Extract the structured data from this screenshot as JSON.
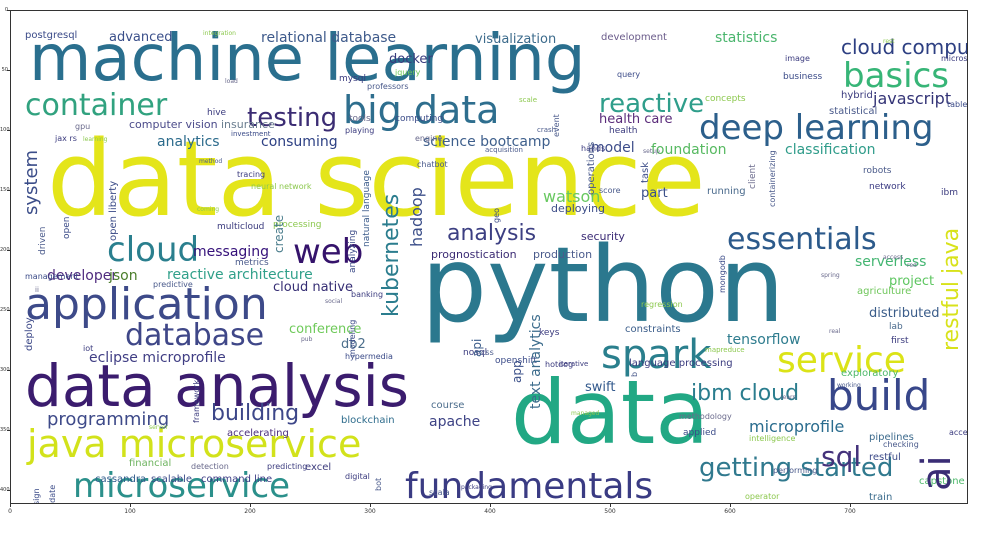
{
  "words": [
    {
      "text": "machine learning",
      "color": "#2a6f8e"
    },
    {
      "text": "data science",
      "color": "#e4e51a"
    },
    {
      "text": "python",
      "color": "#2b788e"
    },
    {
      "text": "data",
      "color": "#22a884"
    },
    {
      "text": "data analysis",
      "color": "#3b1c6e"
    },
    {
      "text": "java microservice",
      "color": "#d2e21b"
    },
    {
      "text": "big data",
      "color": "#2e6e8e"
    },
    {
      "text": "application",
      "color": "#3d4a89"
    },
    {
      "text": "deep learning",
      "color": "#2c5f8b"
    },
    {
      "text": "container",
      "color": "#31a27f"
    },
    {
      "text": "microservice",
      "color": "#2b908b"
    },
    {
      "text": "fundamentals",
      "color": "#3a3b83"
    },
    {
      "text": "cloud",
      "color": "#2a7f8e"
    },
    {
      "text": "web",
      "color": "#35136b"
    },
    {
      "text": "service",
      "color": "#dbe317"
    },
    {
      "text": "spark",
      "color": "#2a7f8d"
    },
    {
      "text": "build",
      "color": "#38478a"
    },
    {
      "text": "database",
      "color": "#3f4788"
    },
    {
      "text": "essentials",
      "color": "#2c5a8b"
    },
    {
      "text": "basics",
      "color": "#37b577"
    },
    {
      "text": "cloud computing",
      "color": "#2d3f82"
    },
    {
      "text": "testing",
      "color": "#3b2c73"
    },
    {
      "text": "reactive",
      "color": "#2f9e8b"
    },
    {
      "text": "getting started",
      "color": "#30798e"
    },
    {
      "text": "sql",
      "color": "#44327b"
    },
    {
      "text": "analysis",
      "color": "#3c3f82"
    },
    {
      "text": "ibm cloud",
      "color": "#2a7d8e"
    },
    {
      "text": "building",
      "color": "#3d4789"
    },
    {
      "text": "programming",
      "color": "#3e4a89"
    },
    {
      "text": "eclipse microprofile",
      "color": "#403e84"
    },
    {
      "text": "reactive architecture",
      "color": "#30a08a"
    },
    {
      "text": "javascript",
      "color": "#333376"
    },
    {
      "text": "messaging",
      "color": "#35117a"
    },
    {
      "text": "cloud native",
      "color": "#362e74"
    },
    {
      "text": "developer",
      "color": "#4f2b7e"
    },
    {
      "text": "json",
      "color": "#4a7d2a"
    },
    {
      "text": "consuming",
      "color": "#2c3f83"
    },
    {
      "text": "analytics",
      "color": "#2c6b8c"
    },
    {
      "text": "classification",
      "color": "#2f9c8a"
    },
    {
      "text": "foundation",
      "color": "#56b960"
    },
    {
      "text": "model",
      "color": "#3d4d8a"
    },
    {
      "text": "science bootcamp",
      "color": "#3e5f8c"
    },
    {
      "text": "health care",
      "color": "#5a2b7a"
    },
    {
      "text": "watson",
      "color": "#68c860"
    },
    {
      "text": "part",
      "color": "#3b5089"
    },
    {
      "text": "tensorflow",
      "color": "#2e7c8e"
    },
    {
      "text": "microprofile",
      "color": "#2a6c8e"
    },
    {
      "text": "serverless",
      "color": "#43b571"
    },
    {
      "text": "project",
      "color": "#5ec661"
    },
    {
      "text": "distributed",
      "color": "#3b5d8a"
    },
    {
      "text": "conference",
      "color": "#6fca5a"
    },
    {
      "text": "db2",
      "color": "#4d6f8c"
    },
    {
      "text": "apache",
      "color": "#3e4385"
    },
    {
      "text": "swift",
      "color": "#31588c"
    },
    {
      "text": "relational database",
      "color": "#3e5a8b"
    },
    {
      "text": "visualization",
      "color": "#3c6b8c"
    },
    {
      "text": "statistics",
      "color": "#4ab56d"
    },
    {
      "text": "advanced",
      "color": "#3a4f8a"
    },
    {
      "text": "postgresql",
      "color": "#3b4b89"
    },
    {
      "text": "docker",
      "color": "#383b7d"
    },
    {
      "text": "computer vision",
      "color": "#4b4b8a"
    },
    {
      "text": "insurance",
      "color": "#6a7d8f"
    },
    {
      "text": "development",
      "color": "#6a5b8a"
    },
    {
      "text": "production",
      "color": "#4a5b8c"
    },
    {
      "text": "deploying",
      "color": "#3d4e88"
    },
    {
      "text": "security",
      "color": "#3b2b76"
    },
    {
      "text": "prognostication",
      "color": "#3b2b74"
    },
    {
      "text": "course",
      "color": "#4c6d8c"
    },
    {
      "text": "blockchain",
      "color": "#2e6c8c"
    },
    {
      "text": "accelerating",
      "color": "#4b2e7c"
    },
    {
      "text": "command line",
      "color": "#3a3b84"
    },
    {
      "text": "scalable",
      "color": "#3a4b89"
    },
    {
      "text": "cassandra",
      "color": "#2e5b8b"
    },
    {
      "text": "excel",
      "color": "#3c3b7c"
    },
    {
      "text": "financial",
      "color": "#6db35f"
    },
    {
      "text": "network",
      "color": "#3a3a82"
    },
    {
      "text": "exploratory",
      "color": "#4db86a"
    },
    {
      "text": "pipelines",
      "color": "#3c6a8c"
    },
    {
      "text": "restful",
      "color": "#3c4a88"
    },
    {
      "text": "capstone",
      "color": "#4db86a"
    },
    {
      "text": "train",
      "color": "#3b6b8c"
    },
    {
      "text": "language processing",
      "color": "#3a3b7e"
    },
    {
      "text": "constraints",
      "color": "#3b5d8a"
    },
    {
      "text": "ai",
      "color": "#3a2d75"
    },
    {
      "text": "restful java",
      "color": "#d8e21a"
    },
    {
      "text": "kubernetes",
      "color": "#2b7d8e"
    },
    {
      "text": "system",
      "color": "#3b4d89"
    },
    {
      "text": "hadoop",
      "color": "#3b4e89"
    },
    {
      "text": "text analytics",
      "color": "#3c6c8c"
    },
    {
      "text": "api",
      "color": "#3c5d8b"
    },
    {
      "text": "app",
      "color": "#3b5089"
    },
    {
      "text": "create",
      "color": "#4b7d8c"
    },
    {
      "text": "open liberty",
      "color": "#3d4d88"
    },
    {
      "text": "open",
      "color": "#3b4b88"
    },
    {
      "text": "driven",
      "color": "#4a5a8b"
    },
    {
      "text": "deploy",
      "color": "#3b4787"
    },
    {
      "text": "analyzing",
      "color": "#3b4b88"
    },
    {
      "text": "natural language",
      "color": "#3b5b8b"
    },
    {
      "text": "operations",
      "color": "#4a5a8b"
    },
    {
      "text": "task",
      "color": "#3d4e89"
    },
    {
      "text": "running",
      "color": "#4a6a8c"
    },
    {
      "text": "client",
      "color": "#6a6a8c"
    },
    {
      "text": "robots",
      "color": "#4a5a8a"
    },
    {
      "text": "ibm",
      "color": "#3b3b7e"
    },
    {
      "text": "agriculture",
      "color": "#6ec65a"
    },
    {
      "text": "lab",
      "color": "#4a6a8c"
    },
    {
      "text": "first",
      "color": "#3b3b7e"
    },
    {
      "text": "hybrid",
      "color": "#3b3b7e"
    },
    {
      "text": "statistical",
      "color": "#4a5a8b"
    },
    {
      "text": "table",
      "color": "#3b4b88"
    },
    {
      "text": "business",
      "color": "#3b4b88"
    },
    {
      "text": "image",
      "color": "#3b3b7e"
    },
    {
      "text": "query",
      "color": "#3b4b88"
    },
    {
      "text": "concepts",
      "color": "#8cc84e"
    },
    {
      "text": "mysql",
      "color": "#3b3b7e"
    },
    {
      "text": "jquery",
      "color": "#6ec65a"
    },
    {
      "text": "professors",
      "color": "#4a5a8b"
    },
    {
      "text": "tools",
      "color": "#6a6a8c"
    },
    {
      "text": "computing",
      "color": "#3b4b88"
    },
    {
      "text": "health",
      "color": "#3b3b7e"
    },
    {
      "text": "gpu",
      "color": "#6a6a8c"
    },
    {
      "text": "jax rs",
      "color": "#3b3b7e"
    },
    {
      "text": "investment",
      "color": "#3b4b88"
    },
    {
      "text": "playing",
      "color": "#3b3b7e"
    },
    {
      "text": "hive",
      "color": "#3b3b7e"
    },
    {
      "text": "metrics",
      "color": "#4a5a8b"
    },
    {
      "text": "multicloud",
      "color": "#3b3b7e"
    },
    {
      "text": "processing",
      "color": "#8cc84e"
    },
    {
      "text": "management",
      "color": "#3b4b88"
    },
    {
      "text": "predictive",
      "color": "#4a5a8b"
    },
    {
      "text": "banking",
      "color": "#3b3b7e"
    },
    {
      "text": "modeling",
      "color": "#3b4b88"
    },
    {
      "text": "nosql",
      "color": "#3b3b7e"
    },
    {
      "text": "iot",
      "color": "#3b3b7e"
    },
    {
      "text": "hypermedia",
      "color": "#3b4b88"
    },
    {
      "text": "css",
      "color": "#4a5a8b"
    },
    {
      "text": "keys",
      "color": "#3b3b7e"
    },
    {
      "text": "hotdog",
      "color": "#3b3b7e"
    },
    {
      "text": "openshift",
      "color": "#3b4b88"
    },
    {
      "text": "mapreduce",
      "color": "#8cc84e"
    },
    {
      "text": "intelligence",
      "color": "#8cc84e"
    },
    {
      "text": "applied",
      "color": "#3b4b88"
    },
    {
      "text": "methodology",
      "color": "#6a6a8c"
    },
    {
      "text": "checking",
      "color": "#4a5a8b"
    },
    {
      "text": "performing",
      "color": "#4a5a8b"
    },
    {
      "text": "operator",
      "color": "#8cc84e"
    },
    {
      "text": "design",
      "color": "#3b4b88"
    },
    {
      "text": "update",
      "color": "#3b4b88"
    },
    {
      "text": "detection",
      "color": "#6a6a8c"
    },
    {
      "text": "framework",
      "color": "#3b3b7e"
    },
    {
      "text": "scala",
      "color": "#4a5a8b"
    },
    {
      "text": "accessing",
      "color": "#4a5a8b"
    },
    {
      "text": "bot",
      "color": "#3b3b7e"
    },
    {
      "text": "chatbot",
      "color": "#3b4b88"
    },
    {
      "text": "engine",
      "color": "#4a5a8b"
    },
    {
      "text": "hands",
      "color": "#6a6a8c"
    },
    {
      "text": "crash",
      "color": "#3b3b7e"
    },
    {
      "text": "microshed",
      "color": "#4a5a8b"
    },
    {
      "text": "geo",
      "color": "#3b3b7e"
    },
    {
      "text": "neural network",
      "color": "#4a5a8b"
    },
    {
      "text": "tracing",
      "color": "#4a5a8b"
    },
    {
      "text": "event",
      "color": "#8cc84e"
    },
    {
      "text": "containerizing",
      "color": "#3b3b7e"
    },
    {
      "text": "regression",
      "color": "#4a5a8b"
    },
    {
      "text": "predicting",
      "color": "#3b4b88"
    },
    {
      "text": "digital",
      "color": "#8cc84e"
    },
    {
      "text": "b",
      "color": "#3b3b7e"
    },
    {
      "text": "ii",
      "color": "#3b3b7e"
    },
    {
      "text": "working",
      "color": "#6a6a8c"
    },
    {
      "text": "real",
      "color": "#6a6a8c"
    },
    {
      "text": "mongodb",
      "color": "#4a5a8b"
    },
    {
      "text": "score",
      "color": "#6a6a8c"
    },
    {
      "text": "method",
      "color": "#3b4b88"
    },
    {
      "text": "scale",
      "color": "#4a5a8b"
    },
    {
      "text": "packaging",
      "color": "#4a5a8b"
    },
    {
      "text": "load",
      "color": "#8cc84e"
    },
    {
      "text": "pub",
      "color": "#3b3b7e"
    },
    {
      "text": "social",
      "color": "#6a6a8c"
    },
    {
      "text": "coming",
      "color": "#6a6a8c"
    },
    {
      "text": "spring",
      "color": "#6a6a8c"
    },
    {
      "text": "access",
      "color": "#8cc84e"
    },
    {
      "text": "learn",
      "color": "#6a6a8c"
    },
    {
      "text": "server",
      "color": "#6a6a8c"
    },
    {
      "text": "managed",
      "color": "#6a6a8c"
    },
    {
      "text": "rest",
      "color": "#8cc84e"
    },
    {
      "text": "integration",
      "color": "#8cc84e"
    },
    {
      "text": "setup",
      "color": "#8cc84e"
    },
    {
      "text": "iterative",
      "color": "#8cc84e"
    },
    {
      "text": "acquisition",
      "color": "#6a6a8c"
    },
    {
      "text": "red",
      "color": "#3b3b7e"
    },
    {
      "text": "learning",
      "color": "#4a5a8b"
    },
    {
      "text": "professions",
      "color": "#6a6a8c"
    },
    {
      "text": "visualize",
      "color": "#8cc84e"
    }
  ],
  "axes": {
    "x_ticks": [
      "0",
      "100",
      "200",
      "300",
      "400",
      "500",
      "600",
      "700"
    ],
    "y_ticks": [
      "0",
      "50",
      "100",
      "150",
      "200",
      "250",
      "300",
      "350",
      "400",
      "450"
    ]
  }
}
